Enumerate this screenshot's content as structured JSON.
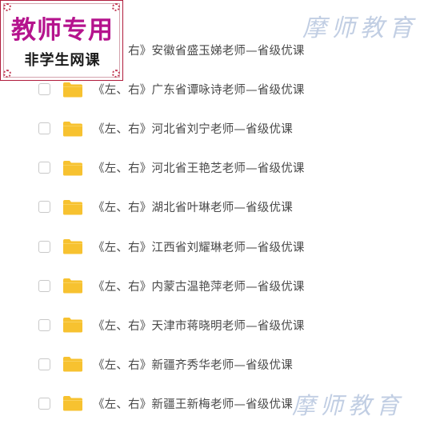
{
  "badge": {
    "title": "教师专用",
    "subtitle": "非学生网课"
  },
  "watermark": {
    "top": "摩师教育",
    "bottom": "摩师教育"
  },
  "colors": {
    "folder": "#f7c230",
    "badge_title": "#b5138d",
    "badge_border": "#b01c3c",
    "watermark": "#b7c6df"
  },
  "files": [
    {
      "name": "《左、右》安徽省盛玉娣老师—省级优课",
      "icon": "folder-icon",
      "checked": false
    },
    {
      "name": "《左、右》广东省谭咏诗老师—省级优课",
      "icon": "folder-icon",
      "checked": false
    },
    {
      "name": "《左、右》河北省刘宁老师—省级优课",
      "icon": "folder-icon",
      "checked": false
    },
    {
      "name": "《左、右》河北省王艳芝老师—省级优课",
      "icon": "folder-icon",
      "checked": false
    },
    {
      "name": "《左、右》湖北省叶琳老师—省级优课",
      "icon": "folder-icon",
      "checked": false
    },
    {
      "name": "《左、右》江西省刘耀琳老师—省级优课",
      "icon": "folder-icon",
      "checked": false
    },
    {
      "name": "《左、右》内蒙古温艳萍老师—省级优课",
      "icon": "folder-icon",
      "checked": false
    },
    {
      "name": "《左、右》天津市蒋晓明老师—省级优课",
      "icon": "folder-icon",
      "checked": false
    },
    {
      "name": "《左、右》新疆齐秀华老师—省级优课",
      "icon": "folder-icon",
      "checked": false
    },
    {
      "name": "《左、右》新疆王新梅老师—省级优课",
      "icon": "folder-icon",
      "checked": false
    }
  ]
}
